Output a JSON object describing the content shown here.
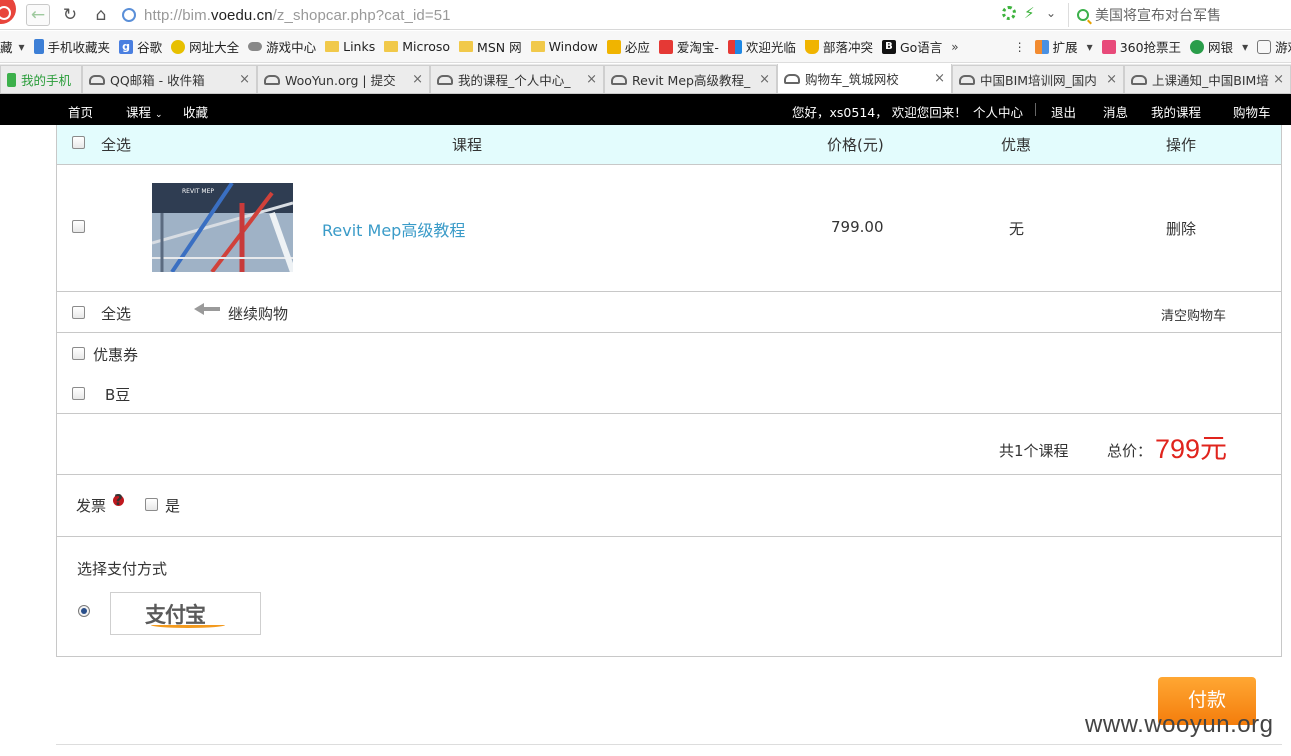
{
  "browser": {
    "url_prefix": "http://bim.",
    "url_domain": "voedu.cn",
    "url_path": "/z_shopcar.php?cat_id=51",
    "search_text": "美国将宣布对台军售"
  },
  "bookmarks": [
    {
      "label": "藏",
      "icon": "none"
    },
    {
      "label": "手机收藏夹",
      "icon": "phone-icon"
    },
    {
      "label": "谷歌",
      "icon": "google-icon"
    },
    {
      "label": "网址大全",
      "icon": "plus-icon"
    },
    {
      "label": "游戏中心",
      "icon": "gamepad-icon"
    },
    {
      "label": "Links",
      "icon": "folder-icon"
    },
    {
      "label": "Microso",
      "icon": "folder-icon"
    },
    {
      "label": "MSN 网",
      "icon": "folder-icon"
    },
    {
      "label": "Window",
      "icon": "folder-icon"
    },
    {
      "label": "必应",
      "icon": "bing-icon"
    },
    {
      "label": "爱淘宝-",
      "icon": "taobao-icon"
    },
    {
      "label": "欢迎光临",
      "icon": "flag-icon"
    },
    {
      "label": "部落冲突",
      "icon": "trophy-icon"
    },
    {
      "label": "Go语言",
      "icon": "go-icon"
    }
  ],
  "bookmarks_right": [
    {
      "label": "扩展",
      "icon": "extension-icon"
    },
    {
      "label": "360抢票王",
      "icon": "ticket-icon"
    },
    {
      "label": "网银",
      "icon": "yuan-icon"
    },
    {
      "label": "游戏",
      "icon": "game-face-icon"
    }
  ],
  "tabs": [
    {
      "label": "我的手机",
      "active": false,
      "close": ""
    },
    {
      "label": "QQ邮箱 - 收件箱",
      "active": false,
      "close": "×"
    },
    {
      "label": "WooYun.org | 提交",
      "active": false,
      "close": "×"
    },
    {
      "label": "我的课程_个人中心_",
      "active": false,
      "close": "×"
    },
    {
      "label": "Revit Mep高级教程_",
      "active": false,
      "close": "×"
    },
    {
      "label": "购物车_筑城网校",
      "active": true,
      "close": "×"
    },
    {
      "label": "中国BIM培训网_国内",
      "active": false,
      "close": "×"
    },
    {
      "label": "上课通知_中国BIM培",
      "active": false,
      "close": "×"
    }
  ],
  "site_nav": {
    "home": "首页",
    "courses": "课程",
    "favorites": "收藏",
    "greeting": "您好，xs0514， 欢迎您回来！",
    "personal_center": "个人中心",
    "logout": "退出",
    "messages": "消息",
    "my_courses": "我的课程",
    "cart": "购物车"
  },
  "cart": {
    "header": {
      "select_all": "全选",
      "course": "课程",
      "price": "价格(元)",
      "discount": "优惠",
      "action": "操作"
    },
    "items": [
      {
        "thumb_text": "REVIT MEP",
        "title": "Revit Mep高级教程",
        "price": "799.00",
        "discount": "无",
        "action": "删除"
      }
    ],
    "select_all": "全选",
    "continue_shopping": "继续购物",
    "clear_cart": "清空购物车",
    "coupon": "优惠券",
    "b_beans": "B豆",
    "count_label": "共1个课程",
    "total_label": "总价：",
    "total_value": "799元",
    "invoice_label": "发票",
    "invoice_yes": "是",
    "payment_title": "选择支付方式",
    "payment_method": "支付宝"
  },
  "pay_button": "付款",
  "watermark": "www.wooyun.org"
}
